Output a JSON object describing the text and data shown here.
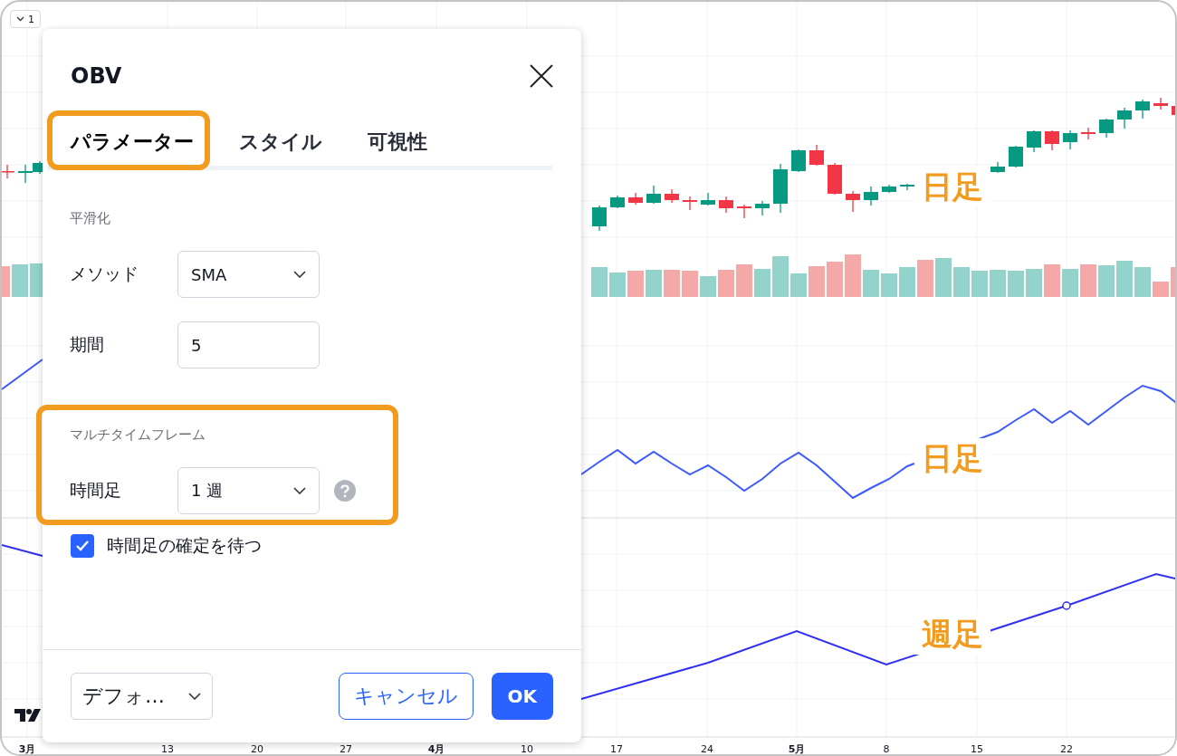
{
  "chart": {
    "interval_button": "1",
    "x_axis_labels": [
      {
        "label": "3月",
        "month": true
      },
      {
        "label": "13",
        "month": false
      },
      {
        "label": "20",
        "month": false
      },
      {
        "label": "27",
        "month": false
      },
      {
        "label": "4月",
        "month": true
      },
      {
        "label": "10",
        "month": false
      },
      {
        "label": "17",
        "month": false
      },
      {
        "label": "24",
        "month": false
      },
      {
        "label": "5月",
        "month": true
      },
      {
        "label": "8",
        "month": false
      },
      {
        "label": "15",
        "month": false
      },
      {
        "label": "22",
        "month": false
      }
    ],
    "annotations": [
      "日足",
      "日足",
      "週足"
    ]
  },
  "dialog": {
    "title": "OBV",
    "tabs": [
      {
        "label": "パラメーター",
        "selected": true,
        "highlighted": true
      },
      {
        "label": "スタイル",
        "selected": false,
        "highlighted": false
      },
      {
        "label": "可視性",
        "selected": false,
        "highlighted": false
      }
    ],
    "sections": [
      {
        "heading": "平滑化",
        "highlighted": false,
        "fields": [
          {
            "kind": "select",
            "label": "メソッド",
            "value": "SMA",
            "help": false
          },
          {
            "kind": "input",
            "label": "期間",
            "value": "5",
            "help": false
          }
        ]
      },
      {
        "heading": "マルチタイムフレーム",
        "highlighted": true,
        "fields": [
          {
            "kind": "select",
            "label": "時間足",
            "value": "1 週",
            "help": true
          }
        ]
      }
    ],
    "checkbox": {
      "label": "時間足の確定を待つ",
      "checked": true
    },
    "footer": {
      "template": "デフォ…",
      "cancel": "キャンセル",
      "ok": "OK"
    }
  }
}
